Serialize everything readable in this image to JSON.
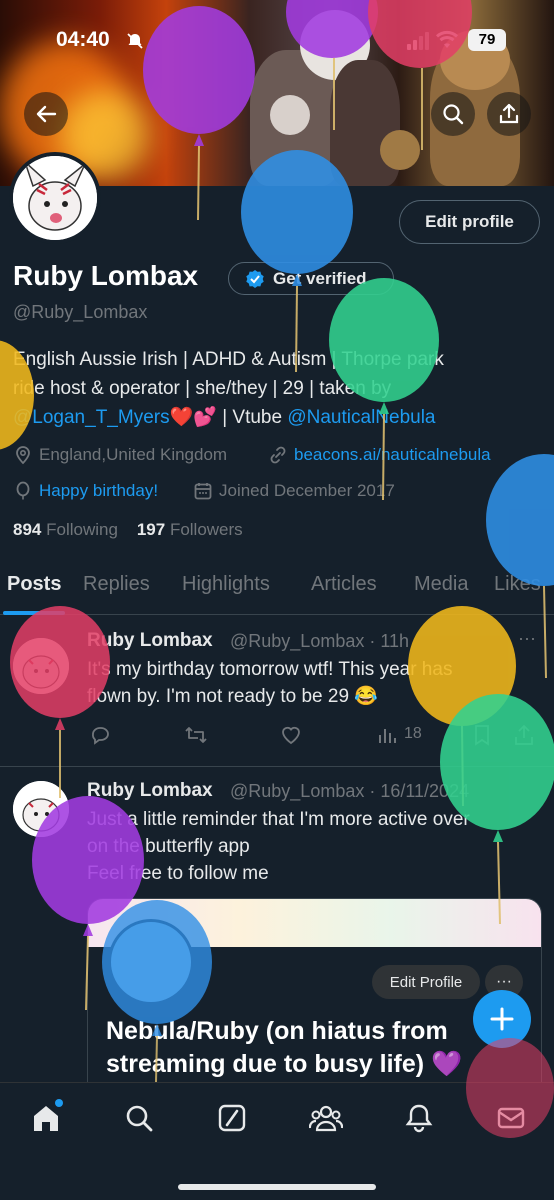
{
  "status_bar": {
    "time": "04:40",
    "battery": "79"
  },
  "profile": {
    "display_name": "Ruby Lombax",
    "verified_label": "Get verified",
    "handle": "@Ruby_Lombax",
    "edit_profile_label": "Edit profile",
    "bio_line1": "English Aussie Irish | ADHD & Autism | Thorpe park",
    "bio_line2": "ride host & operator | she/they | 29 | taken by",
    "bio_mention1": "@Logan_T_Myers",
    "bio_emoji": "❤️💕",
    "bio_sep": " | Vtube ",
    "bio_mention2": "@NauticalNebula",
    "location": "England,United Kingdom",
    "website": "beacons.ai/nauticalnebula",
    "birthday": "Happy birthday!",
    "joined": "Joined December 2017",
    "following_count": "894",
    "following_label": "Following",
    "followers_count": "197",
    "followers_label": "Followers"
  },
  "tabs": [
    "Posts",
    "Replies",
    "Highlights",
    "Articles",
    "Media",
    "Likes"
  ],
  "posts": [
    {
      "name": "Ruby Lombax",
      "handle": "@Ruby_Lombax · 11h",
      "text_line1": "It's my birthday tomorrow wtf! This year has",
      "text_line2": "flown by. I'm not ready to be 29 😂",
      "views": "18"
    },
    {
      "name": "Ruby Lombax",
      "handle": "@Ruby_Lombax · 16/11/2024",
      "text_line1": "Just a little reminder that I'm more active over",
      "text_line2": "on the butterfly app",
      "text_line3": "Feel free to follow me",
      "card_edit_label": "Edit Profile",
      "card_more": "···",
      "card_title": "Nebula/Ruby (on hiatus from streaming due to busy life) 💜"
    }
  ],
  "colors": {
    "accent": "#1d9bf0",
    "background": "#15202b",
    "muted": "#71767b",
    "heart": "#f91880"
  },
  "icons": [
    "back-arrow-icon",
    "search-icon",
    "share-icon",
    "location-pin-icon",
    "link-icon",
    "balloon-icon",
    "calendar-icon",
    "reply-icon",
    "retweet-icon",
    "like-icon",
    "views-icon",
    "bookmark-icon",
    "compose-plus-icon",
    "home-icon",
    "explore-icon",
    "grok-icon",
    "communities-icon",
    "notifications-icon",
    "messages-icon"
  ]
}
